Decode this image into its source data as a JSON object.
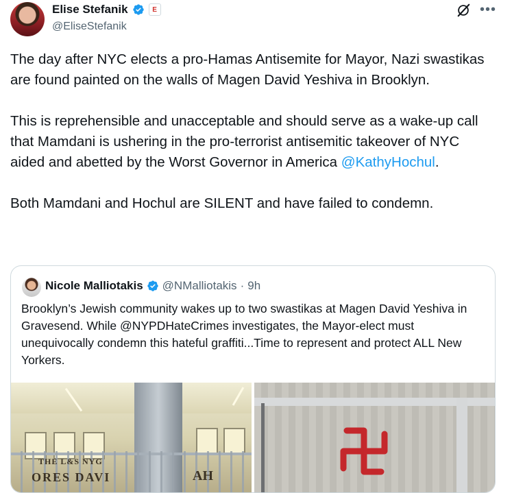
{
  "author": {
    "name": "Elise Stefanik",
    "handle": "@EliseStefanik",
    "affiliation_badge": "E"
  },
  "tweet": {
    "text_part1": "The day after NYC elects a pro-Hamas Antisemite for Mayor, Nazi swastikas are found painted on the walls of Magen David Yeshiva in Brooklyn.\n\nThis is reprehensible and unacceptable and should serve as a wake-up call that Mamdani is ushering in the pro-terrorist antisemitic takeover of NYC aided and abetted by the Worst Governor in America ",
    "mention": "@KathyHochul",
    "text_part2": ".\n\nBoth Mamdani and Hochul are SILENT and have failed to condemn."
  },
  "quote": {
    "name": "Nicole Malliotakis",
    "handle": "@NMalliotakis",
    "separator": "·",
    "time": "9h",
    "text": "Brooklyn’s Jewish community wakes up to two swastikas at Magen David Yeshiva in Gravesend. While @NYPDHateCrimes investigates, the Mayor-elect must unequivocally condemn this hateful graffiti...Time to represent and protect ALL New Yorkers.",
    "image_left_sign_top": "THE L&S NYG",
    "image_left_sign_main": "ORES DAVI",
    "image_left_sign_right": "AH"
  },
  "icons": {
    "verified": "verified-badge-icon",
    "grok": "grok-icon",
    "more": "more-icon"
  },
  "colors": {
    "verified": "#1d9bf0",
    "mention": "#1d9bf0",
    "secondary_text": "#536471",
    "border": "#cfd9de"
  }
}
